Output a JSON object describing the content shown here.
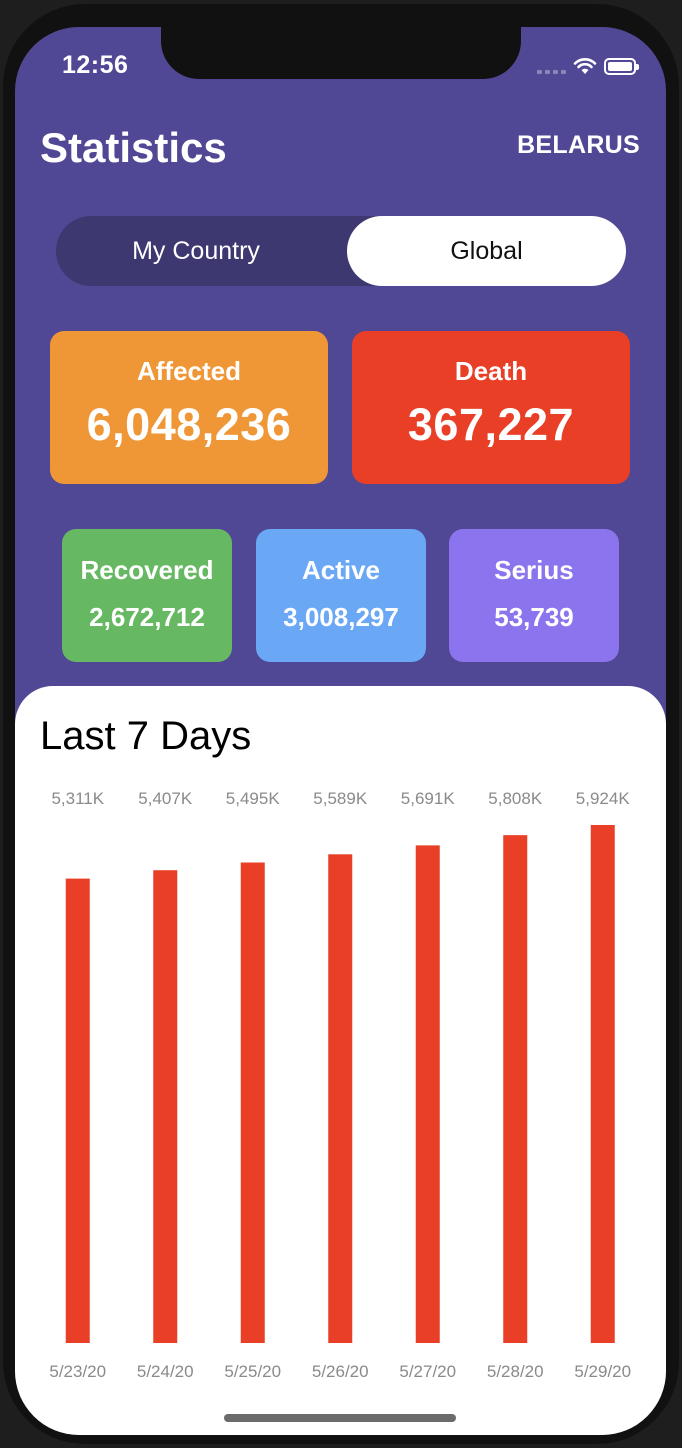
{
  "status": {
    "time": "12:56"
  },
  "header": {
    "title": "Statistics",
    "country": "BELARUS"
  },
  "segmented": {
    "my_country": "My Country",
    "global": "Global",
    "selected": "Global"
  },
  "cards": {
    "affected": {
      "label": "Affected",
      "value": "6,048,236"
    },
    "death": {
      "label": "Death",
      "value": "367,227"
    },
    "recovered": {
      "label": "Recovered",
      "value": "2,672,712"
    },
    "active": {
      "label": "Active",
      "value": "3,008,297"
    },
    "serius": {
      "label": "Serius",
      "value": "53,739"
    }
  },
  "chart_title": "Last 7 Days",
  "chart_data": {
    "type": "bar",
    "title": "Last 7 Days",
    "categories": [
      "5/23/20",
      "5/24/20",
      "5/25/20",
      "5/26/20",
      "5/27/20",
      "5/28/20",
      "5/29/20"
    ],
    "values": [
      5311,
      5407,
      5495,
      5589,
      5691,
      5808,
      5924
    ],
    "value_labels": [
      "5,311K",
      "5,407K",
      "5,495K",
      "5,589K",
      "5,691K",
      "5,808K",
      "5,924K"
    ],
    "color": "#e83f26",
    "ylim": [
      0,
      5924
    ]
  },
  "colors": {
    "background": "#514895",
    "affected": "#ef9737",
    "death": "#e83f26",
    "recovered": "#66b862",
    "active": "#6aa8f5",
    "serius": "#8c74ee"
  }
}
